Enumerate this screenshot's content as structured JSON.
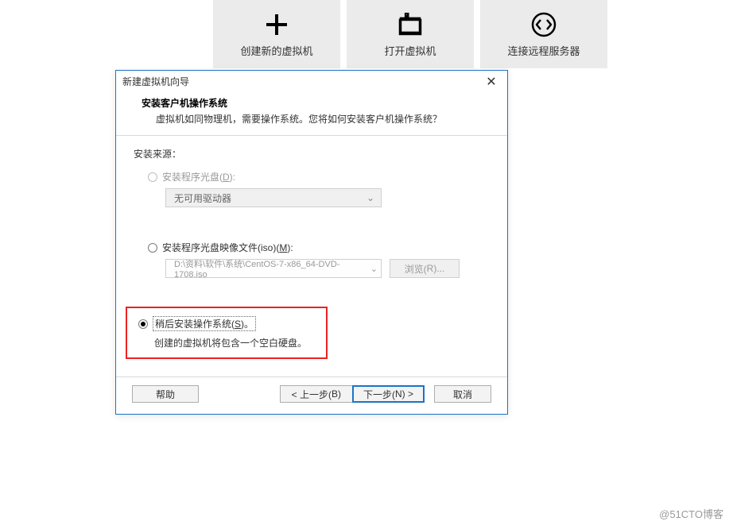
{
  "toolbar": {
    "tiles": [
      {
        "icon": "plus",
        "label": "创建新的虚拟机"
      },
      {
        "icon": "open",
        "label": "打开虚拟机"
      },
      {
        "icon": "connect",
        "label": "连接远程服务器"
      }
    ]
  },
  "dialog": {
    "title": "新建虚拟机向导",
    "header_title": "安装客户机操作系统",
    "header_desc": "虚拟机如同物理机，需要操作系统。您将如何安装客户机操作系统？",
    "source_label": "安装来源：",
    "option_disc": {
      "label_pre": "安装程序光盘(",
      "mnemonic": "D",
      "label_post": "):",
      "dropdown_value": "无可用驱动器"
    },
    "option_iso": {
      "label_pre": "安装程序光盘映像文件(iso)(",
      "mnemonic": "M",
      "label_post": "):",
      "path": "D:\\资料\\软件\\系统\\CentOS-7-x86_64-DVD-1708.iso",
      "browse_pre": "浏览(",
      "browse_mnemonic": "R",
      "browse_post": ")..."
    },
    "option_later": {
      "label_pre": "稍后安装操作系统(",
      "mnemonic": "S",
      "label_post": ")。",
      "sub": "创建的虚拟机将包含一个空白硬盘。"
    },
    "footer": {
      "help": "帮助",
      "back_pre": "< 上一步(",
      "back_mnemonic": "B",
      "back_post": ")",
      "next_pre": "下一步(",
      "next_mnemonic": "N",
      "next_post": ") >",
      "cancel": "取消"
    }
  },
  "watermark": "@51CTO博客"
}
